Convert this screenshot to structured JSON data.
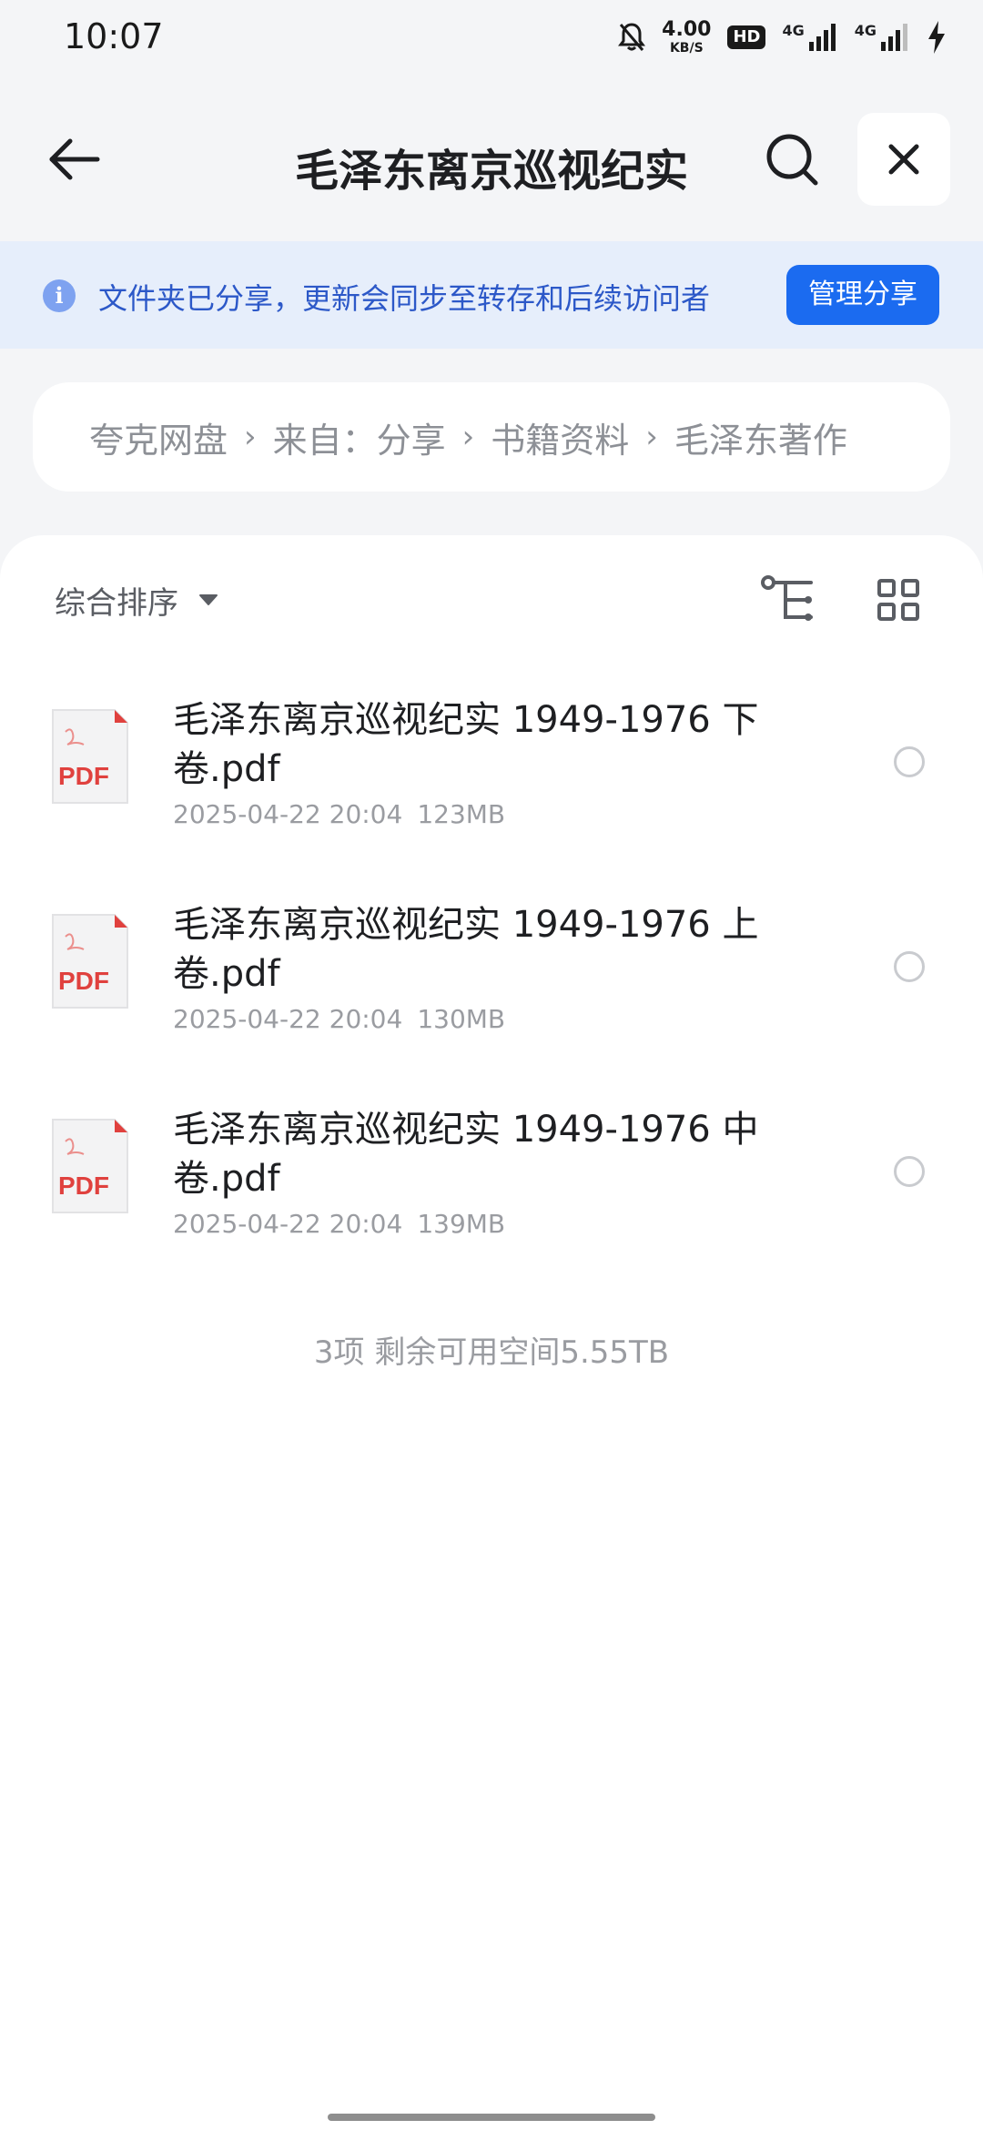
{
  "status_bar": {
    "time": "10:07",
    "net_speed_value": "4.00",
    "net_speed_unit": "KB/S",
    "hd_badge": "HD",
    "signal_1_label": "4G",
    "signal_2_label": "4G"
  },
  "header": {
    "title": "毛泽东离京巡视纪实"
  },
  "share_banner": {
    "notice": "文件夹已分享，更新会同步至转存和后续访问者",
    "manage_button": "管理分享",
    "info_icon_glyph": "i"
  },
  "breadcrumb": {
    "items": [
      "夸克网盘",
      "来自：分享",
      "书籍资料",
      "毛泽东著作"
    ],
    "separator": "›"
  },
  "toolbar": {
    "sort_label": "综合排序"
  },
  "files": [
    {
      "name": "毛泽东离京巡视纪实 1949-1976 下卷.pdf",
      "date": "2025-04-22 20:04",
      "size": "123MB",
      "type_label": "PDF"
    },
    {
      "name": "毛泽东离京巡视纪实 1949-1976 上卷.pdf",
      "date": "2025-04-22 20:04",
      "size": "130MB",
      "type_label": "PDF"
    },
    {
      "name": "毛泽东离京巡视纪实 1949-1976 中卷.pdf",
      "date": "2025-04-22 20:04",
      "size": "139MB",
      "type_label": "PDF"
    }
  ],
  "summary": "3项 剩余可用空间5.55TB",
  "colors": {
    "accent": "#1B6BF0",
    "banner_bg": "#E6EEFB",
    "banner_text": "#2C58C8",
    "pdf_red": "#E0413E"
  }
}
